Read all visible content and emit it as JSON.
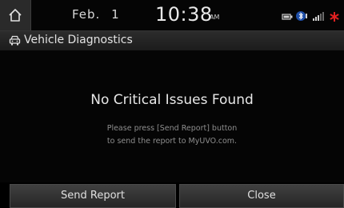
{
  "status_bar": {
    "date": "Feb. 1",
    "time": "10:38",
    "ampm": "AM",
    "icons": [
      "home-icon",
      "battery-icon",
      "bluetooth-icon",
      "signal-icon",
      "bluetooth-star-icon"
    ]
  },
  "title_bar": {
    "title": "Vehicle Diagnostics",
    "icon": "diagnostics-icon"
  },
  "main": {
    "message": "No Critical Issues Found",
    "instruction_line1": "Please press [Send Report] button",
    "instruction_line2": "to send the report to MyUVO.com."
  },
  "buttons": {
    "send_report": "Send Report",
    "close": "Close"
  },
  "colors": {
    "background": "#000000",
    "accent_red": "#e02020"
  }
}
